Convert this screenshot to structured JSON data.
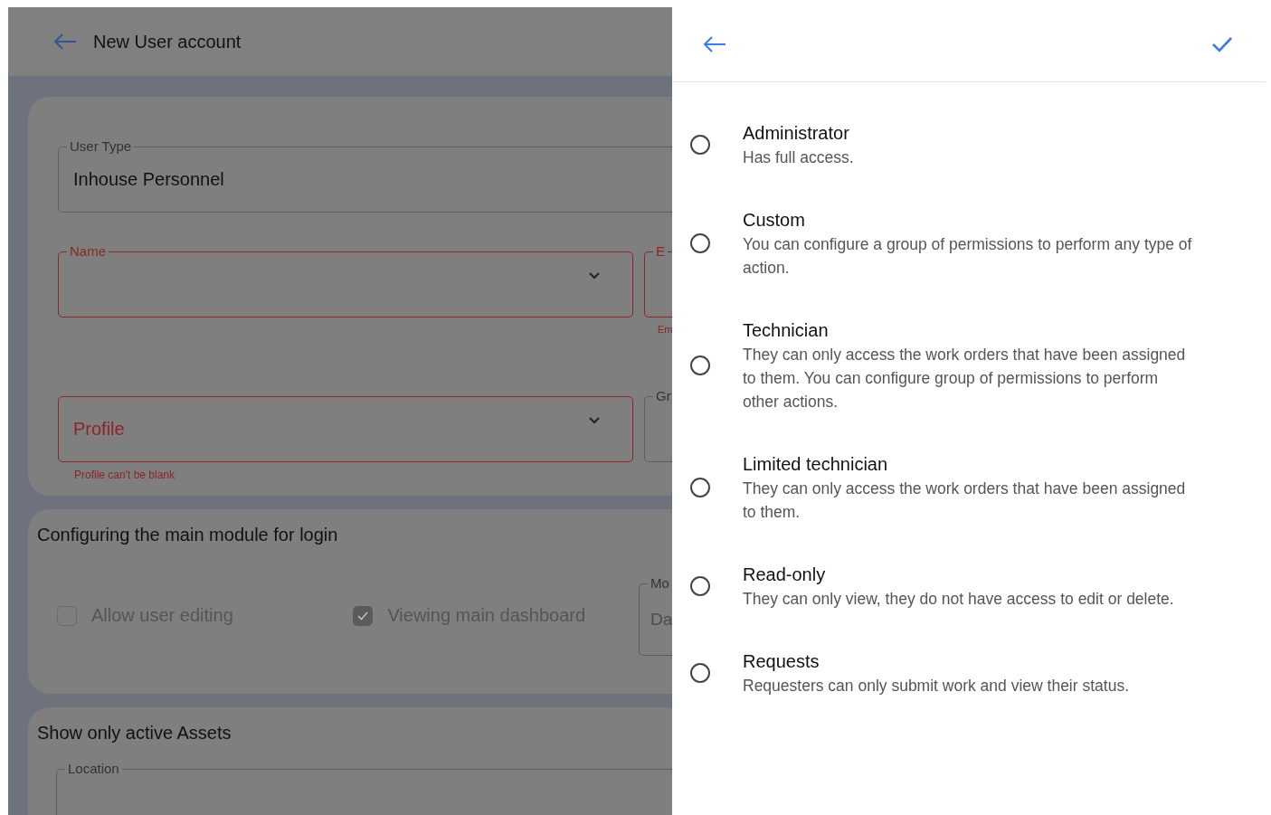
{
  "form_header": {
    "title": "New User account"
  },
  "account_card": {
    "user_type": {
      "label": "User Type",
      "value": "Inhouse Personnel"
    },
    "name": {
      "label": "Name",
      "error": true
    },
    "email": {
      "label": "E",
      "helper": "Em",
      "error": true
    },
    "profile": {
      "label": "Profile",
      "helper": "Profile can't be blank",
      "error": true
    },
    "group": {
      "label": "Gr",
      "error": false
    }
  },
  "login_card": {
    "title": "Configuring the main module for login",
    "checkboxes": [
      {
        "label": "Allow user editing",
        "checked": false
      },
      {
        "label": "Viewing main dashboard",
        "checked": true
      }
    ],
    "module": {
      "label": "Mo",
      "value": "Da"
    }
  },
  "assets_card": {
    "title": "Show only active Assets",
    "location": {
      "label": "Location"
    }
  },
  "profile_panel": {
    "options": [
      {
        "title": "Administrator",
        "description": "Has full access.",
        "selected": false
      },
      {
        "title": "Custom",
        "description": "You can configure a group of permissions to perform any type of action.",
        "selected": false
      },
      {
        "title": "Technician",
        "description": "They can only access the work orders that have been assigned to them. You can configure group of permissions to perform other actions.",
        "selected": false
      },
      {
        "title": "Limited technician",
        "description": "They can only access the work orders that have been assigned to them.",
        "selected": false
      },
      {
        "title": "Read-only",
        "description": "They can only view, they do not have access to edit or delete.",
        "selected": false
      },
      {
        "title": "Requests",
        "description": "Requesters can only submit work and view their status.",
        "selected": false
      }
    ]
  }
}
